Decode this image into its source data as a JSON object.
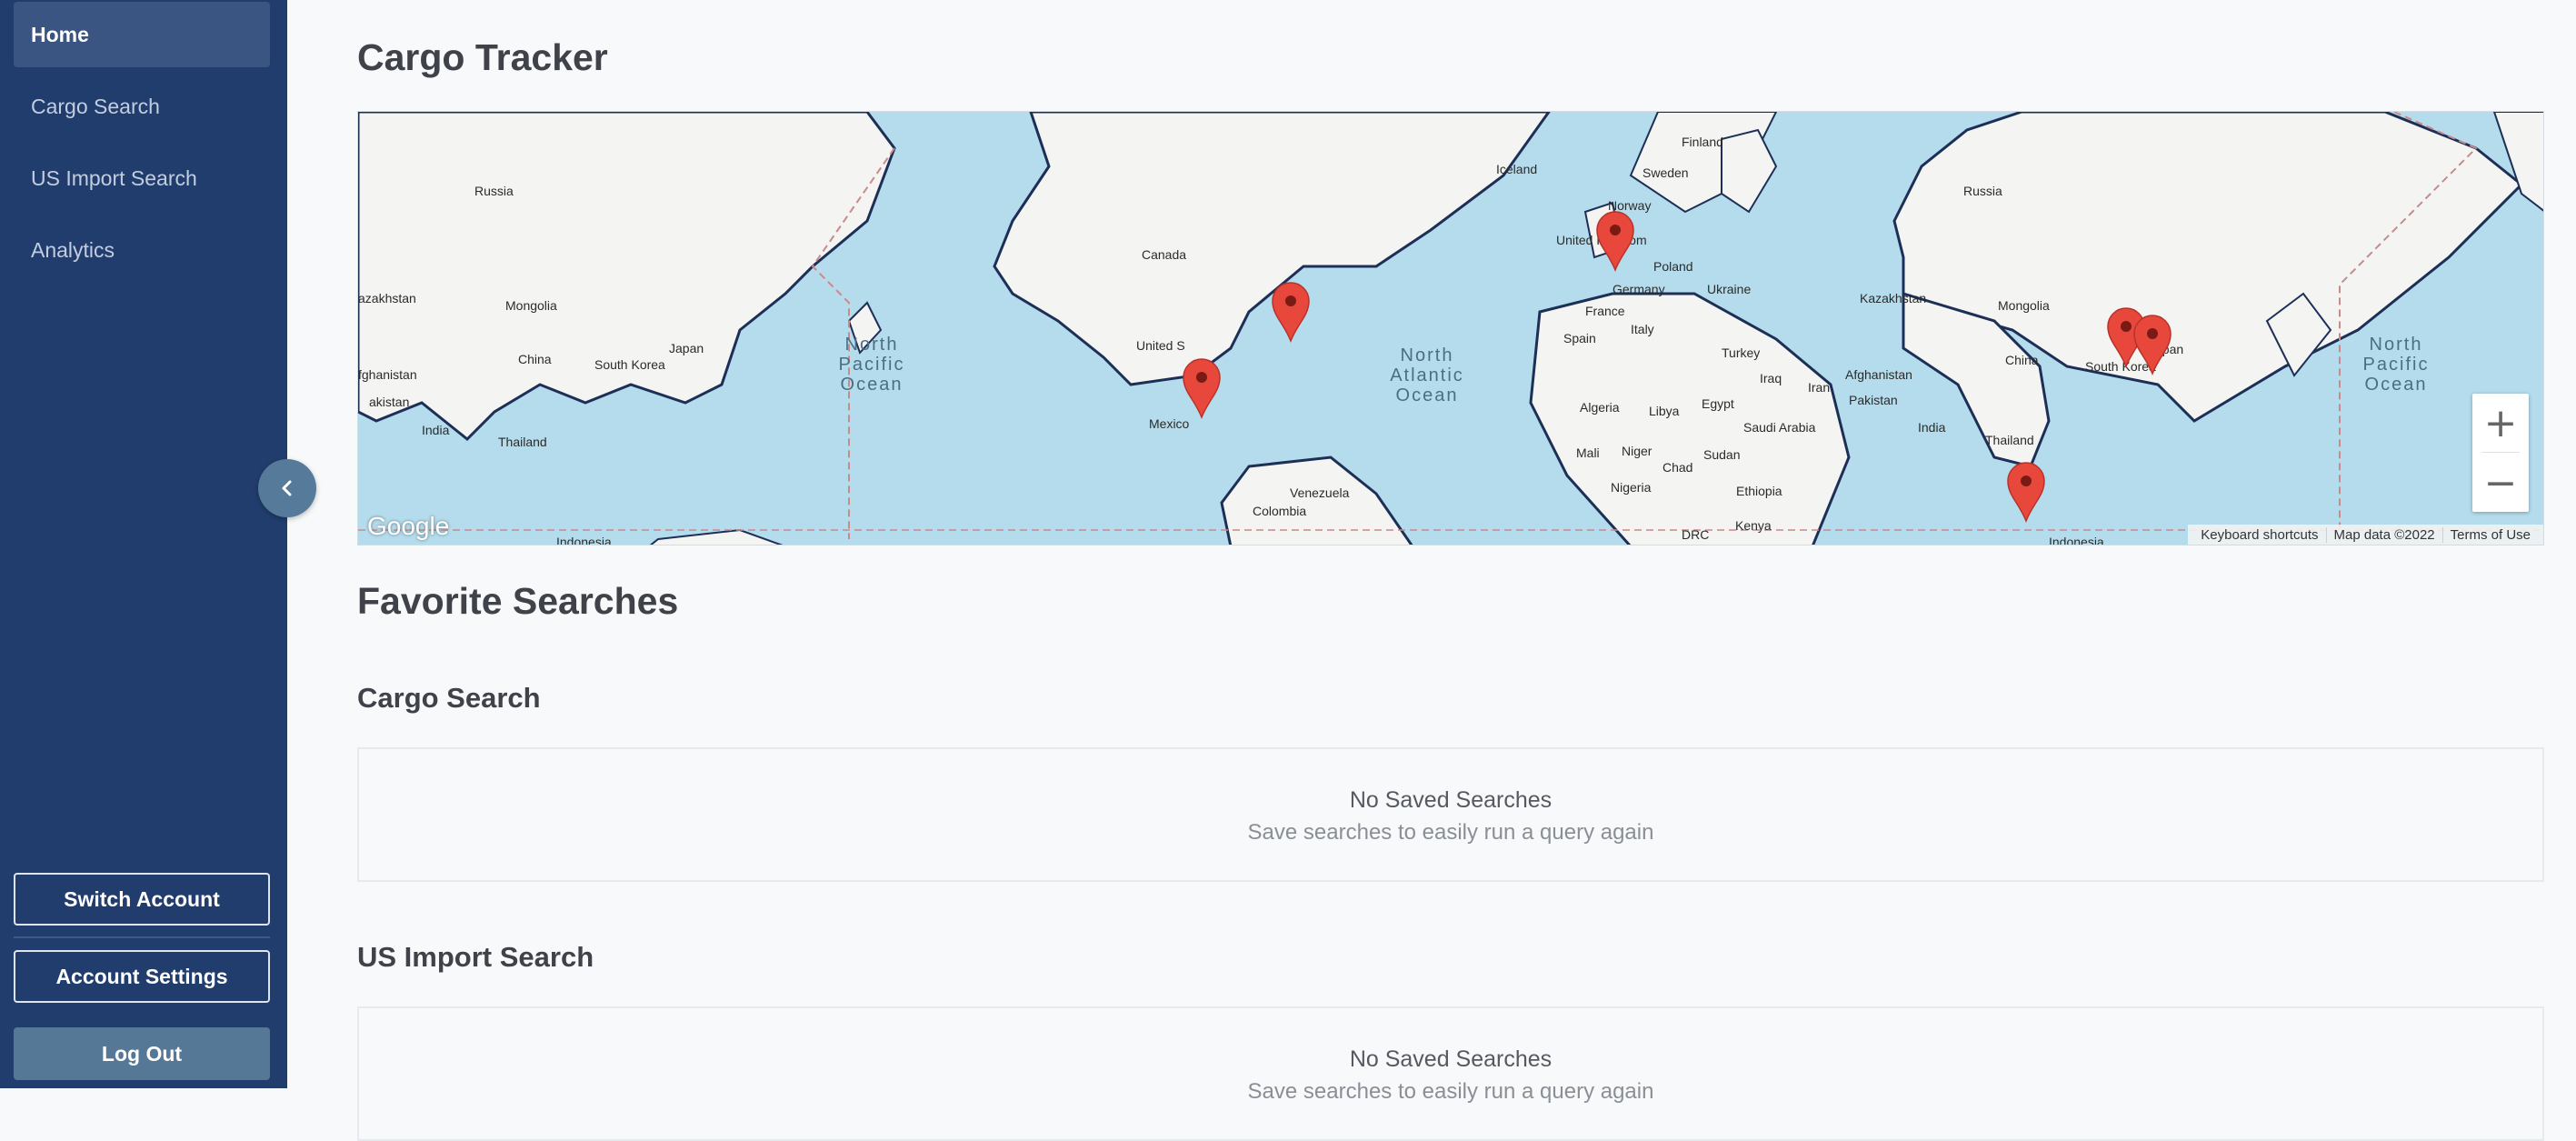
{
  "sidebar": {
    "items": [
      {
        "label": "Home",
        "active": true
      },
      {
        "label": "Cargo Search",
        "active": false
      },
      {
        "label": "US Import Search",
        "active": false
      },
      {
        "label": "Analytics",
        "active": false
      }
    ],
    "switch_account": "Switch Account",
    "account_settings": "Account Settings",
    "log_out": "Log Out",
    "collapse_icon": "chevron-left-icon"
  },
  "main": {
    "title": "Cargo Tracker",
    "favorites_title": "Favorite Searches",
    "sections": [
      {
        "title": "Cargo Search",
        "empty_title": "No Saved Searches",
        "empty_sub": "Save searches to easily run a query again"
      },
      {
        "title": "US Import Search",
        "empty_title": "No Saved Searches",
        "empty_sub": "Save searches to easily run a query again"
      }
    ]
  },
  "map": {
    "logo": "Google",
    "zoom_in": "+",
    "zoom_out": "−",
    "attribution": [
      "Keyboard shortcuts",
      "Map data ©2022",
      "Terms of Use"
    ],
    "labels": [
      "Russia",
      "Mongolia",
      "China",
      "South Korea",
      "Japan",
      "India",
      "Thailand",
      "azakhstan",
      "fghanistan",
      "akistan",
      "Indonesia",
      "Canada",
      "United S",
      "Mexico",
      "Venezuela",
      "Colombia",
      "Iceland",
      "Sweden",
      "Finland",
      "Norway",
      "United Kingdom",
      "Poland",
      "Germany",
      "Ukraine",
      "France",
      "Spain",
      "Italy",
      "Turkey",
      "Kazakhstan",
      "Iraq",
      "Iran",
      "Afghanistan",
      "Pakistan",
      "Saudi Arabia",
      "Algeria",
      "Libya",
      "Egypt",
      "Mali",
      "Niger",
      "Chad",
      "Sudan",
      "Nigeria",
      "Ethiopia",
      "DRC",
      "Kenya",
      "South Korea",
      "Japan"
    ],
    "oceans": [
      "North Pacific Ocean",
      "North Atlantic Ocean",
      "North Pacific Ocean"
    ],
    "marker_count": 6,
    "colors": {
      "ocean": "#b4dcec",
      "land": "#f4f4f2",
      "marker": "#e8483b",
      "border": "#1e2f57"
    }
  },
  "colors": {
    "sidebar": "#213d6d",
    "active_item": "#3a5582",
    "logout": "#567897",
    "collapse": "#567b9a"
  }
}
